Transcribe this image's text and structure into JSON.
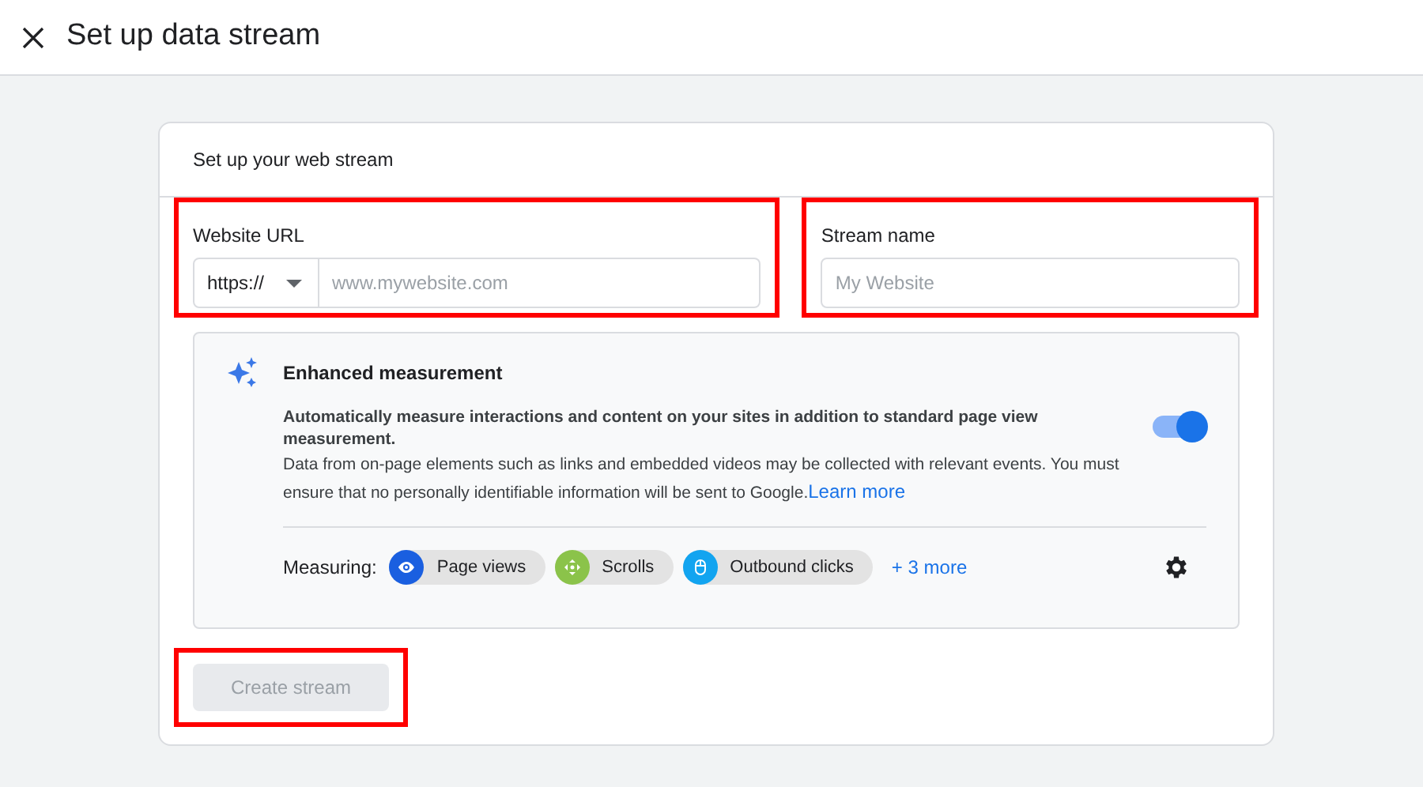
{
  "header": {
    "title": "Set up data stream"
  },
  "card": {
    "title": "Set up your web stream"
  },
  "website_url": {
    "label": "Website URL",
    "protocol": "https://",
    "placeholder": "www.mywebsite.com",
    "highlighted": true
  },
  "stream_name": {
    "label": "Stream name",
    "placeholder": "My Website",
    "highlighted": true
  },
  "enhanced_measurement": {
    "title": "Enhanced measurement",
    "on": true,
    "description": "Automatically measure interactions and content on your sites in addition to standard page view measurement.",
    "note": "Data from on-page elements such as links and embedded videos may be collected with relevant events. You must ensure that no personally identifiable information will be sent to Google.",
    "link": "Learn more",
    "measuring_label": "Measuring:",
    "chips": [
      {
        "label": "Page views",
        "kind": "eye",
        "color": "#1a5fe0"
      },
      {
        "label": "Scrolls",
        "kind": "scroll",
        "color": "#8bc34a"
      },
      {
        "label": "Outbound clicks",
        "kind": "mouse",
        "color": "#12a4f0"
      }
    ],
    "more": "+ 3 more"
  },
  "create_button": {
    "label": "Create stream",
    "disabled": true,
    "highlighted": true
  }
}
